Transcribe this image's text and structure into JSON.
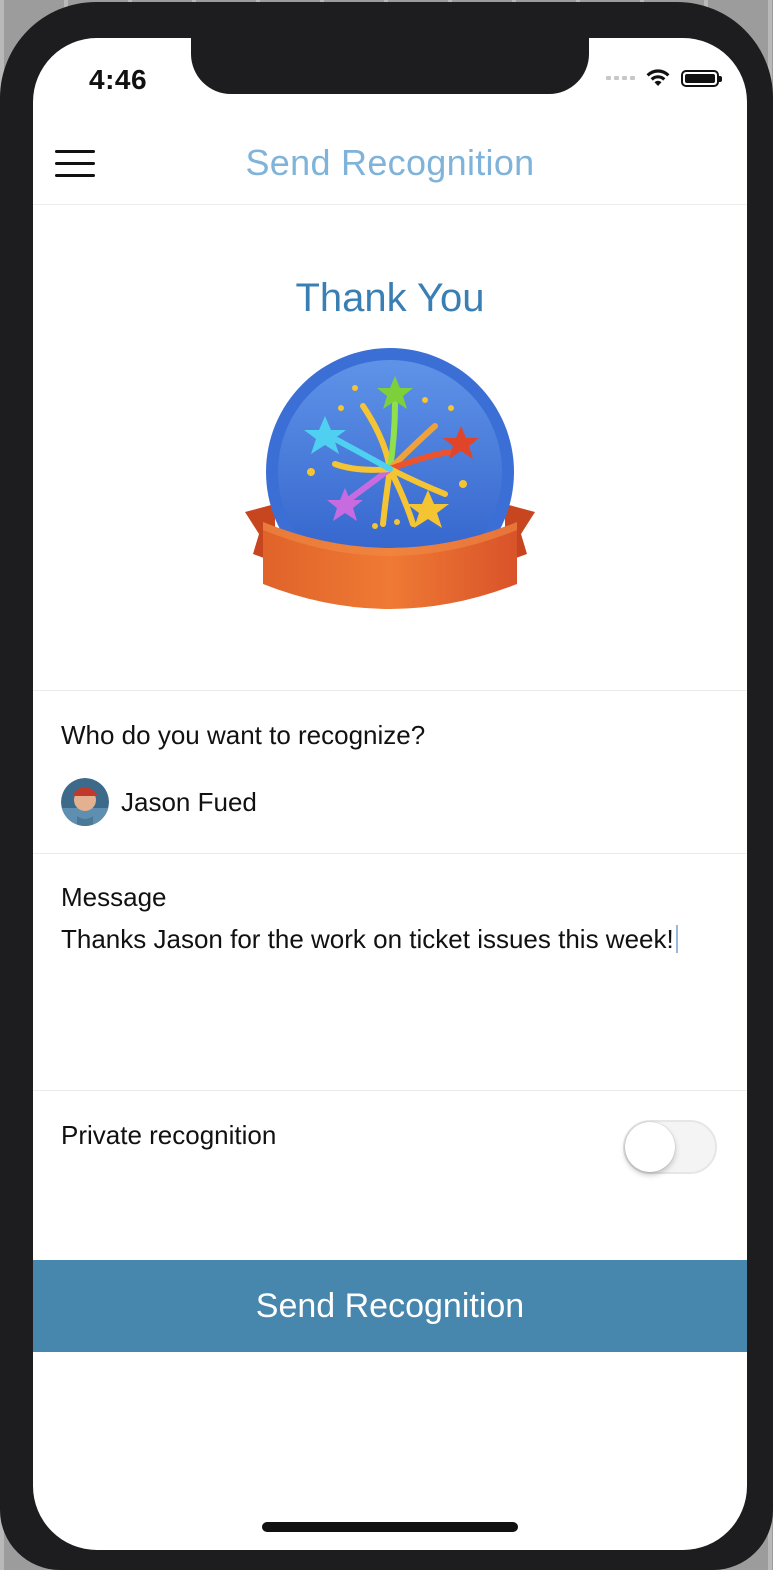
{
  "status_bar": {
    "time": "4:46",
    "icons": [
      "signal-icon",
      "wifi-icon",
      "battery-icon"
    ]
  },
  "header": {
    "menu_icon": "hamburger-menu-icon",
    "title": "Send Recognition"
  },
  "badge": {
    "title": "Thank You",
    "icon": "fireworks-badge-icon"
  },
  "recipient_section": {
    "label": "Who do you want to recognize?",
    "recipient_name": "Jason Fued"
  },
  "message_section": {
    "label": "Message",
    "value": "Thanks Jason for the work on ticket issues this week!"
  },
  "private_section": {
    "label": "Private recognition",
    "enabled": false
  },
  "actions": {
    "send_label": "Send Recognition"
  },
  "colors": {
    "accent": "#4786ad",
    "title_blue": "#3a7fb4",
    "nav_title": "#7fb3d9"
  }
}
